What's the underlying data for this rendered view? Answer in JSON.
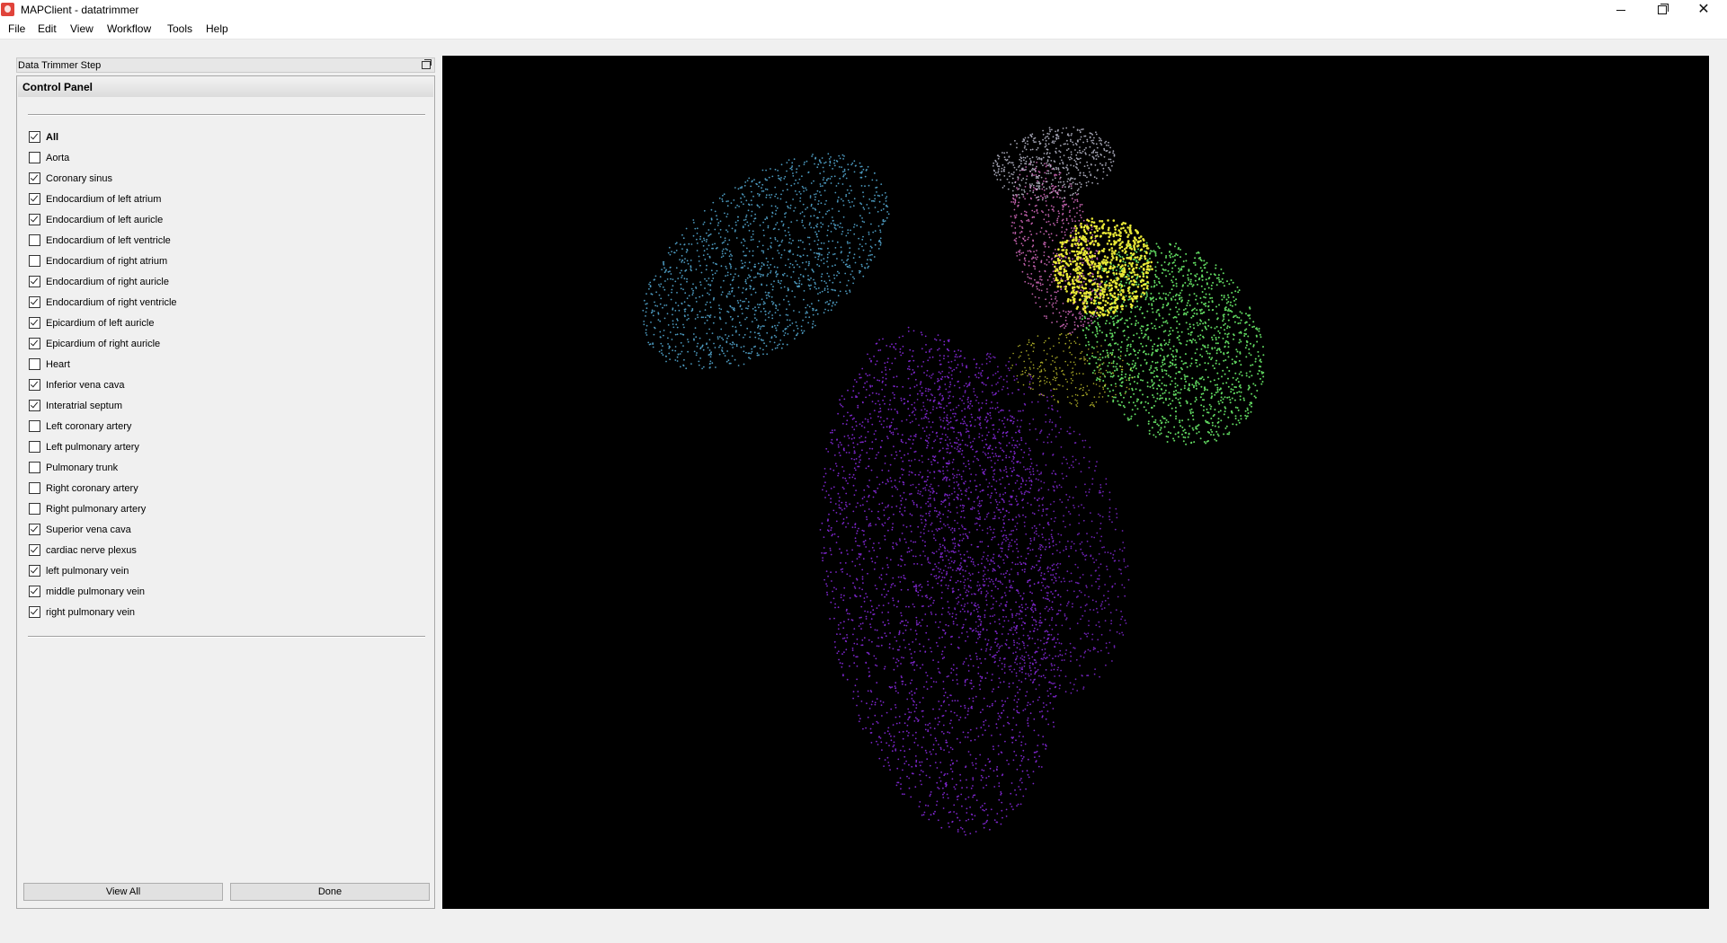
{
  "window": {
    "title": "MAPClient - datatrimmer",
    "minimize_icon": "minimize-icon",
    "maximize_icon": "restore-icon",
    "close_label": "✕"
  },
  "menu": [
    "File",
    "Edit",
    "View",
    "Workflow",
    "Tools",
    "Help"
  ],
  "dock": {
    "title": "Data Trimmer Step",
    "float_icon": "float-icon"
  },
  "control_panel": {
    "header": "Control Panel",
    "items": [
      {
        "label": "All",
        "checked": true,
        "bold": true
      },
      {
        "label": "Aorta",
        "checked": false
      },
      {
        "label": "Coronary sinus",
        "checked": true
      },
      {
        "label": "Endocardium of left atrium",
        "checked": true
      },
      {
        "label": "Endocardium of left auricle",
        "checked": true
      },
      {
        "label": "Endocardium of left ventricle",
        "checked": false
      },
      {
        "label": "Endocardium of right atrium",
        "checked": false
      },
      {
        "label": "Endocardium of right auricle",
        "checked": true
      },
      {
        "label": "Endocardium of right ventricle",
        "checked": true
      },
      {
        "label": "Epicardium of left auricle",
        "checked": true
      },
      {
        "label": "Epicardium of right auricle",
        "checked": true
      },
      {
        "label": "Heart",
        "checked": false
      },
      {
        "label": "Inferior vena cava",
        "checked": true
      },
      {
        "label": "Interatrial septum",
        "checked": true
      },
      {
        "label": "Left coronary artery",
        "checked": false
      },
      {
        "label": "Left pulmonary artery",
        "checked": false
      },
      {
        "label": "Pulmonary trunk",
        "checked": false
      },
      {
        "label": "Right coronary artery",
        "checked": false
      },
      {
        "label": "Right pulmonary artery",
        "checked": false
      },
      {
        "label": "Superior vena cava",
        "checked": true
      },
      {
        "label": "cardiac nerve plexus",
        "checked": true
      },
      {
        "label": "left pulmonary vein",
        "checked": true
      },
      {
        "label": "middle pulmonary vein",
        "checked": true
      },
      {
        "label": "right pulmonary vein",
        "checked": true
      }
    ],
    "view_all_label": "View All",
    "done_label": "Done"
  },
  "scene": {
    "background": "#000000",
    "colors": {
      "blue_region": "#5ab4e0",
      "purple_region": "#8a2be2",
      "green_region": "#6cf06c",
      "yellow_region": "#f5f53a",
      "pink_region": "#e070c8",
      "white_region": "#e8e8ff"
    }
  }
}
